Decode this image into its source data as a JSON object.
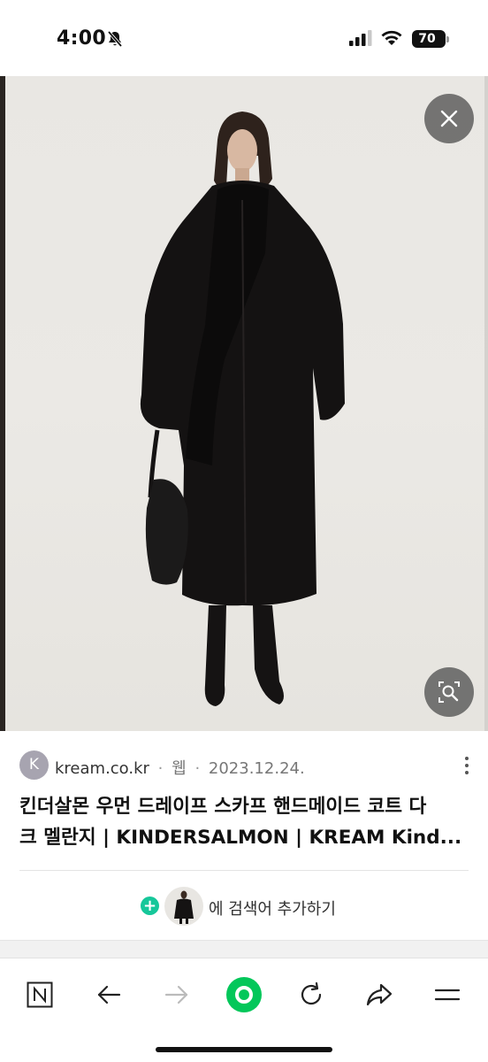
{
  "status_bar": {
    "time": "4:00",
    "battery": "70",
    "icons": [
      "bell-slash-icon",
      "cellular-signal-icon",
      "wifi-icon",
      "battery-icon"
    ]
  },
  "viewer": {
    "image_subject": "model-in-long-black-coat",
    "close_icon": "close-icon",
    "lens_icon": "image-search-icon"
  },
  "result": {
    "favicon_letter": "K",
    "site": "kream.co.kr",
    "separator": "·",
    "source_type": "웹",
    "date": "2023.12.24.",
    "title_line1": "킨더살몬 우먼 드레이프 스카프 핸드메이드 코트 다",
    "title_line2": "크 멜란지 | KINDERSALMON | KREAM Kind...",
    "add_keyword_text": "에 검색어 추가하기"
  },
  "toolbar": {
    "icons": [
      "naver-home-icon",
      "back-arrow-icon",
      "forward-arrow-icon",
      "green-dot-icon",
      "refresh-icon",
      "share-icon",
      "menu-icon"
    ]
  },
  "colors": {
    "accent_green": "#16c79a",
    "toolbar_green": "#03c75a"
  }
}
